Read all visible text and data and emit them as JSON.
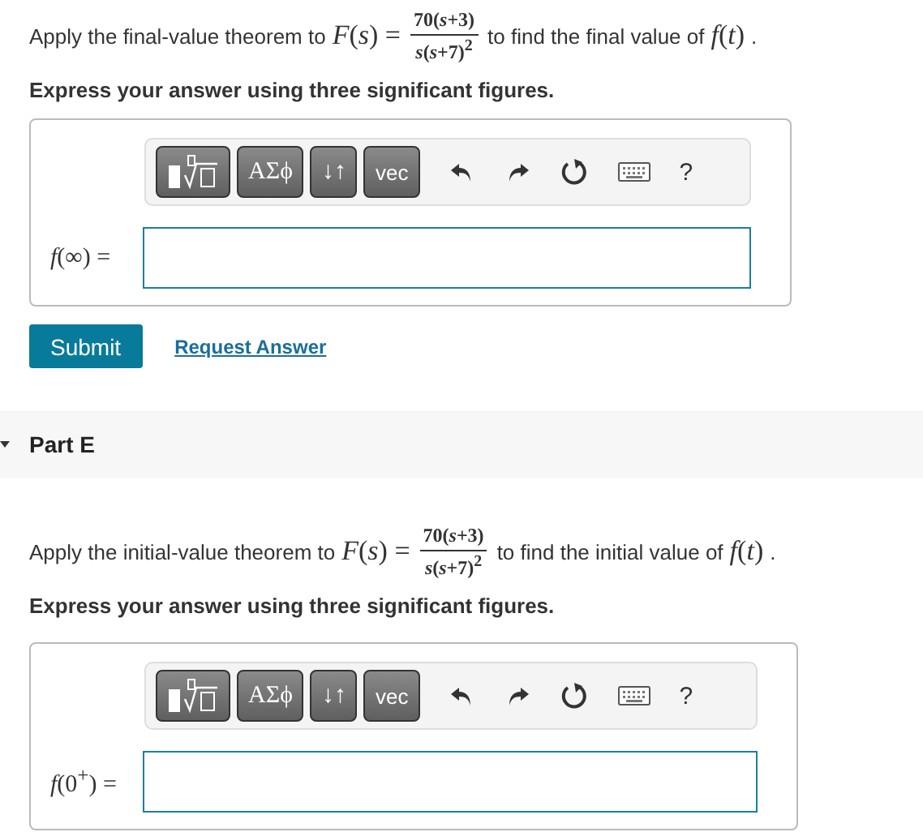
{
  "parts": [
    {
      "question": {
        "before": "Apply the final-value theorem to",
        "lhs": "*F*(*s*) =",
        "numerator": "70(*s*+3)",
        "denominator": "*s*(*s*+7)$^{2}$",
        "after": "to find the final value of",
        "func": "*f*(*t*)",
        "end": "."
      },
      "instruction": "Express your answer using three significant figures.",
      "toolbar": {
        "symbol_buttons": [
          "ΑΣϕ",
          "↓↑",
          "vec"
        ],
        "help": "?"
      },
      "answer_label": "*f*(∞) =",
      "submit": "Submit",
      "request": "Request Answer"
    },
    {
      "header": {
        "title": "Part E",
        "expanded": true
      },
      "question": {
        "before": "Apply the initial-value theorem to",
        "lhs": "*F*(*s*) =",
        "numerator": "70(*s*+3)",
        "denominator": "*s*(*s*+7)$^{2}$",
        "after": "to find the initial value of",
        "func": "*f*(*t*)",
        "end": "."
      },
      "instruction": "Express your answer using three significant figures.",
      "toolbar": {
        "symbol_buttons": [
          "ΑΣϕ",
          "↓↑",
          "vec"
        ],
        "help": "?"
      },
      "answer_label": "*f*(0$^{+}$) ="
    }
  ]
}
